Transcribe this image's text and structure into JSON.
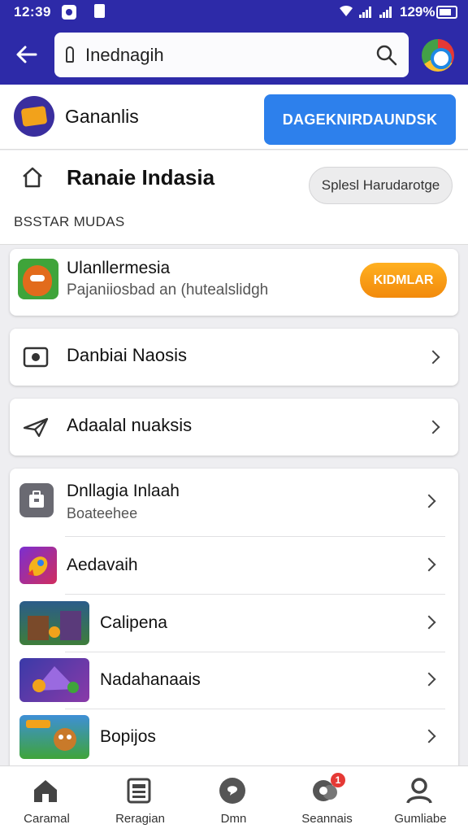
{
  "status_bar": {
    "time": "12:39",
    "battery": "129%"
  },
  "search": {
    "query": "Inednagih"
  },
  "account": {
    "name": "Gananlis",
    "action_label": "DAGEKNIRDAUNDSK"
  },
  "section": {
    "title": "Ranaie Indasia",
    "filter_label": "Splesl Harudarotge",
    "subheading": "BSSTAR MUDAS"
  },
  "promo": {
    "title": "Ulanllermesia",
    "subtitle": "Pajaniiosbad an (hutealslidgh",
    "button": "KIDMLAR"
  },
  "menu_rows": [
    {
      "label": "Danbiai Naosis",
      "icon": "record-icon"
    },
    {
      "label": "Adaalal nuaksis",
      "icon": "send-icon"
    }
  ],
  "list": [
    {
      "title": "Dnllagia Inlaah",
      "subtitle": "Boateehee",
      "icon": "briefcase-icon"
    },
    {
      "title": "Aedavaih",
      "icon": "rocket-icon"
    },
    {
      "title": "Calipena",
      "icon": "game-thumb-icon"
    },
    {
      "title": "Nadahanaais",
      "icon": "game-thumb-icon"
    },
    {
      "title": "Bopijos",
      "icon": "game-thumb-icon"
    }
  ],
  "bottom_nav": [
    {
      "label": "Caramal",
      "icon": "home-icon"
    },
    {
      "label": "Reragian",
      "icon": "newspaper-icon"
    },
    {
      "label": "Dmn",
      "icon": "chat-icon"
    },
    {
      "label": "Seannais",
      "icon": "chat-bubbles-icon",
      "badge": "1"
    },
    {
      "label": "Gumliabe",
      "icon": "person-icon"
    }
  ],
  "colors": {
    "header": "#2d2aa8",
    "primary_button": "#2d80ec",
    "promo_button": "#f5950f",
    "badge": "#e53935"
  }
}
